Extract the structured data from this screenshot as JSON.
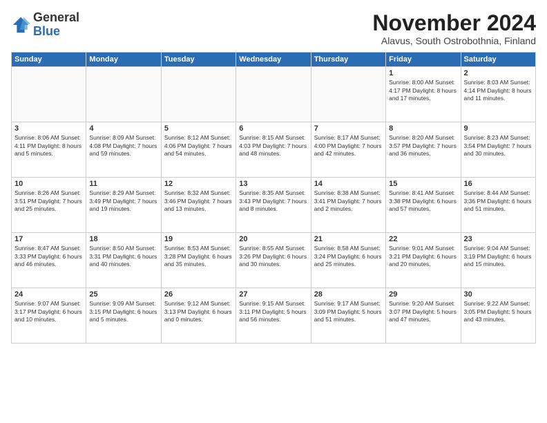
{
  "logo": {
    "general": "General",
    "blue": "Blue"
  },
  "header": {
    "month": "November 2024",
    "location": "Alavus, South Ostrobothnia, Finland"
  },
  "weekdays": [
    "Sunday",
    "Monday",
    "Tuesday",
    "Wednesday",
    "Thursday",
    "Friday",
    "Saturday"
  ],
  "weeks": [
    [
      {
        "day": "",
        "info": ""
      },
      {
        "day": "",
        "info": ""
      },
      {
        "day": "",
        "info": ""
      },
      {
        "day": "",
        "info": ""
      },
      {
        "day": "",
        "info": ""
      },
      {
        "day": "1",
        "info": "Sunrise: 8:00 AM\nSunset: 4:17 PM\nDaylight: 8 hours\nand 17 minutes."
      },
      {
        "day": "2",
        "info": "Sunrise: 8:03 AM\nSunset: 4:14 PM\nDaylight: 8 hours\nand 11 minutes."
      }
    ],
    [
      {
        "day": "3",
        "info": "Sunrise: 8:06 AM\nSunset: 4:11 PM\nDaylight: 8 hours\nand 5 minutes."
      },
      {
        "day": "4",
        "info": "Sunrise: 8:09 AM\nSunset: 4:08 PM\nDaylight: 7 hours\nand 59 minutes."
      },
      {
        "day": "5",
        "info": "Sunrise: 8:12 AM\nSunset: 4:06 PM\nDaylight: 7 hours\nand 54 minutes."
      },
      {
        "day": "6",
        "info": "Sunrise: 8:15 AM\nSunset: 4:03 PM\nDaylight: 7 hours\nand 48 minutes."
      },
      {
        "day": "7",
        "info": "Sunrise: 8:17 AM\nSunset: 4:00 PM\nDaylight: 7 hours\nand 42 minutes."
      },
      {
        "day": "8",
        "info": "Sunrise: 8:20 AM\nSunset: 3:57 PM\nDaylight: 7 hours\nand 36 minutes."
      },
      {
        "day": "9",
        "info": "Sunrise: 8:23 AM\nSunset: 3:54 PM\nDaylight: 7 hours\nand 30 minutes."
      }
    ],
    [
      {
        "day": "10",
        "info": "Sunrise: 8:26 AM\nSunset: 3:51 PM\nDaylight: 7 hours\nand 25 minutes."
      },
      {
        "day": "11",
        "info": "Sunrise: 8:29 AM\nSunset: 3:49 PM\nDaylight: 7 hours\nand 19 minutes."
      },
      {
        "day": "12",
        "info": "Sunrise: 8:32 AM\nSunset: 3:46 PM\nDaylight: 7 hours\nand 13 minutes."
      },
      {
        "day": "13",
        "info": "Sunrise: 8:35 AM\nSunset: 3:43 PM\nDaylight: 7 hours\nand 8 minutes."
      },
      {
        "day": "14",
        "info": "Sunrise: 8:38 AM\nSunset: 3:41 PM\nDaylight: 7 hours\nand 2 minutes."
      },
      {
        "day": "15",
        "info": "Sunrise: 8:41 AM\nSunset: 3:38 PM\nDaylight: 6 hours\nand 57 minutes."
      },
      {
        "day": "16",
        "info": "Sunrise: 8:44 AM\nSunset: 3:36 PM\nDaylight: 6 hours\nand 51 minutes."
      }
    ],
    [
      {
        "day": "17",
        "info": "Sunrise: 8:47 AM\nSunset: 3:33 PM\nDaylight: 6 hours\nand 46 minutes."
      },
      {
        "day": "18",
        "info": "Sunrise: 8:50 AM\nSunset: 3:31 PM\nDaylight: 6 hours\nand 40 minutes."
      },
      {
        "day": "19",
        "info": "Sunrise: 8:53 AM\nSunset: 3:28 PM\nDaylight: 6 hours\nand 35 minutes."
      },
      {
        "day": "20",
        "info": "Sunrise: 8:55 AM\nSunset: 3:26 PM\nDaylight: 6 hours\nand 30 minutes."
      },
      {
        "day": "21",
        "info": "Sunrise: 8:58 AM\nSunset: 3:24 PM\nDaylight: 6 hours\nand 25 minutes."
      },
      {
        "day": "22",
        "info": "Sunrise: 9:01 AM\nSunset: 3:21 PM\nDaylight: 6 hours\nand 20 minutes."
      },
      {
        "day": "23",
        "info": "Sunrise: 9:04 AM\nSunset: 3:19 PM\nDaylight: 6 hours\nand 15 minutes."
      }
    ],
    [
      {
        "day": "24",
        "info": "Sunrise: 9:07 AM\nSunset: 3:17 PM\nDaylight: 6 hours\nand 10 minutes."
      },
      {
        "day": "25",
        "info": "Sunrise: 9:09 AM\nSunset: 3:15 PM\nDaylight: 6 hours\nand 5 minutes."
      },
      {
        "day": "26",
        "info": "Sunrise: 9:12 AM\nSunset: 3:13 PM\nDaylight: 6 hours\nand 0 minutes."
      },
      {
        "day": "27",
        "info": "Sunrise: 9:15 AM\nSunset: 3:11 PM\nDaylight: 5 hours\nand 56 minutes."
      },
      {
        "day": "28",
        "info": "Sunrise: 9:17 AM\nSunset: 3:09 PM\nDaylight: 5 hours\nand 51 minutes."
      },
      {
        "day": "29",
        "info": "Sunrise: 9:20 AM\nSunset: 3:07 PM\nDaylight: 5 hours\nand 47 minutes."
      },
      {
        "day": "30",
        "info": "Sunrise: 9:22 AM\nSunset: 3:05 PM\nDaylight: 5 hours\nand 43 minutes."
      }
    ]
  ]
}
